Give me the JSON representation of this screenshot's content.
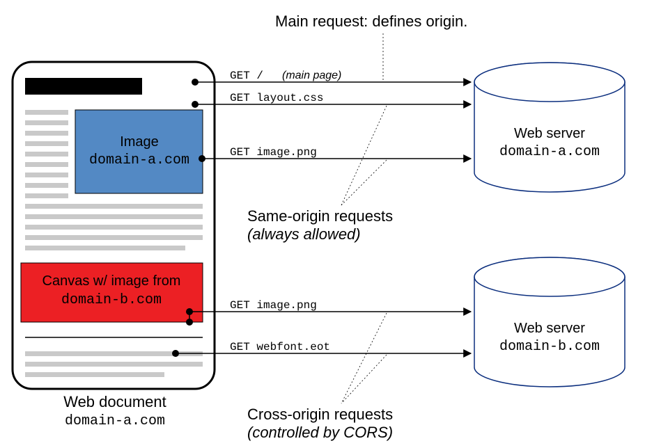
{
  "header": {
    "main_request": "Main request: defines origin."
  },
  "doc": {
    "image_label1": "Image",
    "image_label2": "domain-a.com",
    "canvas_label1": "Canvas w/ image from",
    "canvas_label2": "domain-b.com",
    "caption1": "Web document",
    "caption2": "domain-a.com"
  },
  "requests": {
    "r1a": "GET /",
    "r1b": "(main page)",
    "r2": "GET layout.css",
    "r3": "GET image.png",
    "r4": "GET image.png",
    "r5": "GET webfont.eot"
  },
  "groups": {
    "same1": "Same-origin requests",
    "same2": "(always allowed)",
    "cross1": "Cross-origin requests",
    "cross2": "(controlled by CORS)"
  },
  "servers": {
    "a_label": "Web server",
    "a_domain": "domain-a.com",
    "b_label": "Web server",
    "b_domain": "domain-b.com"
  }
}
